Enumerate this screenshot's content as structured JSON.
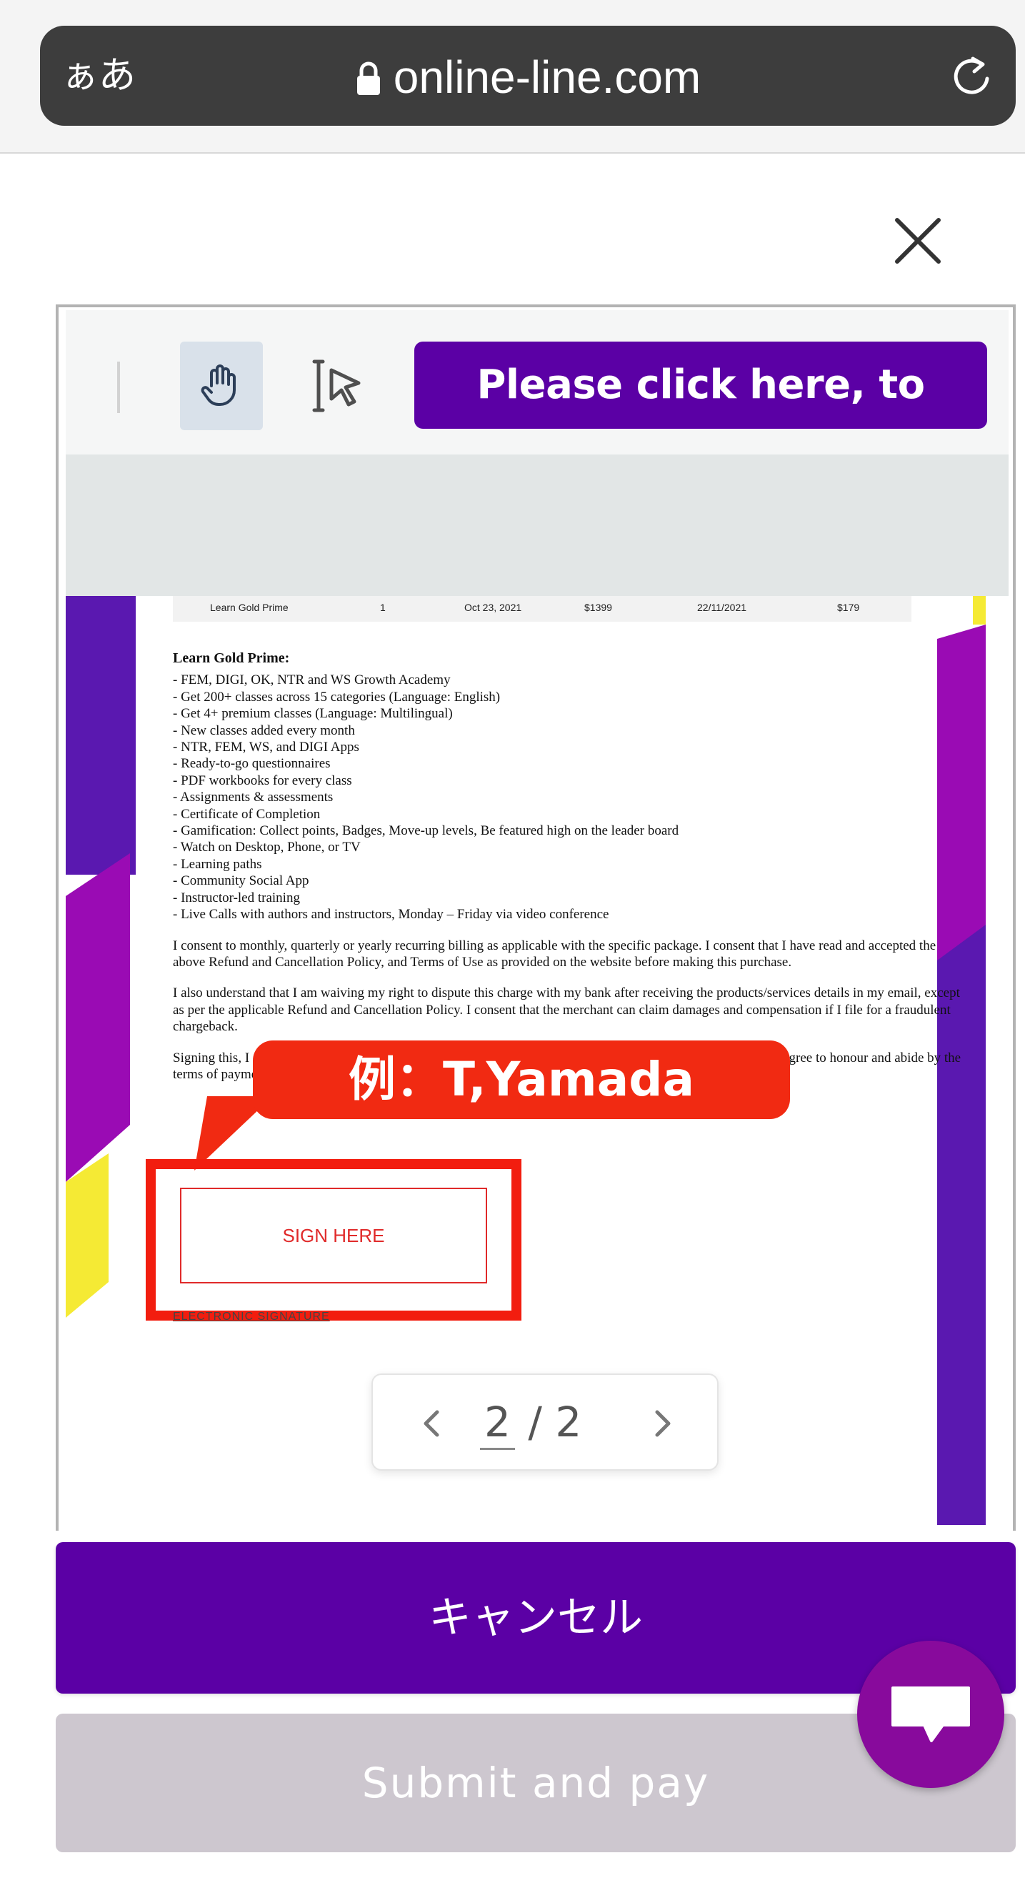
{
  "browser": {
    "text_size_label": "ぁあ",
    "url": "online-line.com"
  },
  "toolbar": {
    "scroll_button_label": "Please click here, to scroll"
  },
  "document": {
    "table_row": {
      "product": "Learn Gold Prime",
      "quantity": "1",
      "date": "Oct 23, 2021",
      "price": "$1399",
      "next_date": "22/11/2021",
      "amount": "$179"
    },
    "heading": "Learn Gold Prime:",
    "features": [
      "- FEM, DIGI, OK, NTR and WS Growth Academy",
      "- Get 200+ classes across 15 categories (Language: English)",
      "- Get 4+ premium classes (Language: Multilingual)",
      "- New classes added every month",
      "- NTR, FEM, WS, and DIGI Apps",
      "- Ready-to-go questionnaires",
      "- PDF workbooks for every class",
      "- Assignments & assessments",
      "- Certificate of Completion",
      "- Gamification: Collect points, Badges, Move-up levels, Be featured high on the leader board",
      "- Watch on Desktop, Phone, or TV",
      "- Learning paths",
      "- Community Social App",
      "- Instructor-led training",
      "- Live Calls with authors and instructors, Monday – Friday via video conference"
    ],
    "paragraphs": [
      "I consent to monthly, quarterly or yearly recurring billing as applicable with the specific package. I consent that I have read and accepted the above Refund and Cancellation Policy, and Terms of Use as provided on the website before making this purchase.",
      "I also understand that I am waiving my right to dispute this charge with my bank after receiving the products/services details in my email, except as per the applicable Refund and Cancellation Policy. I consent that the merchant can claim damages and compensation if I file for a fraudulent chargeback.",
      "Signing this, I acknowledge the charges described herein and assume full responsibility for the said charges and agree to honour and abide by the terms of payment."
    ],
    "sign_here_label": "SIGN HERE",
    "esignature_label": "ELECTRONIC SIGNATURE"
  },
  "annotation": {
    "callout_text": "例：T,Yamada"
  },
  "pager": {
    "current": "2",
    "total_text": "/ 2"
  },
  "actions": {
    "cancel_label": "キャンセル",
    "submit_label": "Submit and pay"
  },
  "colors": {
    "brand_purple": "#5b00a5",
    "chat_purple": "#880a9c",
    "annotation_red": "#f12a12",
    "disabled_gray": "#cdc7cf"
  }
}
